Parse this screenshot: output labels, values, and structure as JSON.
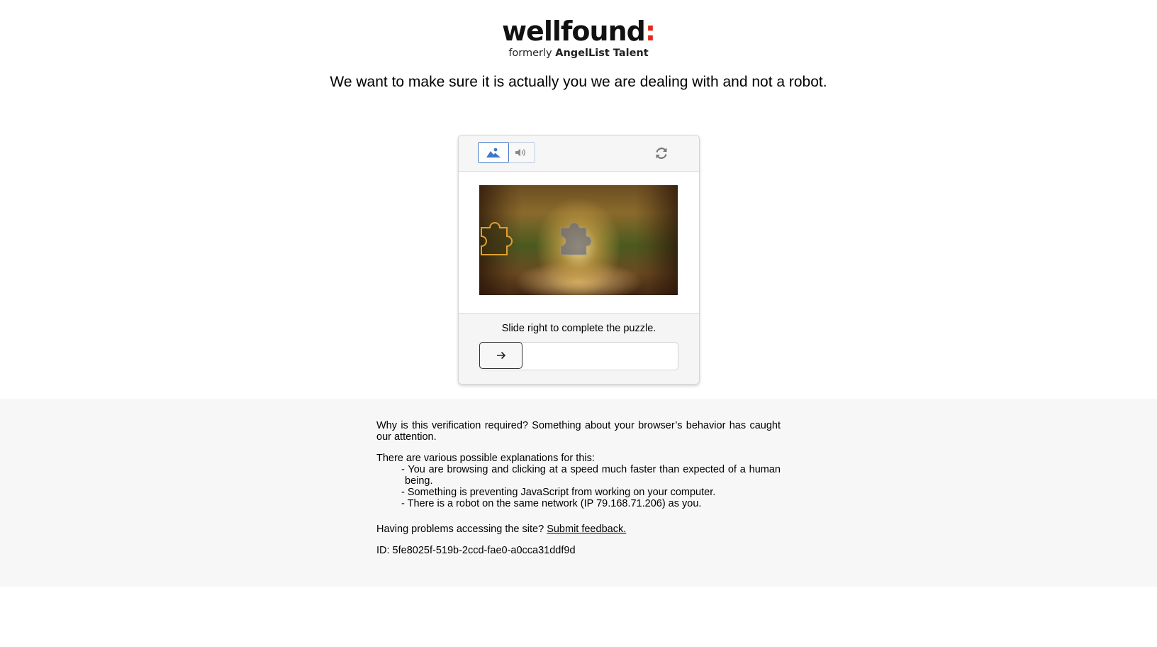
{
  "brand": {
    "name": "wellfound",
    "colon": ":",
    "formerly_prefix": "formerly",
    "formerly_name": "AngelList Talent",
    "accent_color": "#e0291a"
  },
  "headline": "We want to make sure it is actually you we are dealing with and not a robot.",
  "captcha": {
    "tabs": [
      {
        "label": "image",
        "icon": "image-icon",
        "selected": true
      },
      {
        "label": "audio",
        "icon": "speaker-icon",
        "selected": false
      }
    ],
    "refresh_icon": "refresh-icon",
    "instruction": "Slide right to complete the puzzle.",
    "slider_icon": "arrow-right-icon",
    "accent_color": "#3f79c5"
  },
  "info": {
    "why": "Why is this verification required? Something about your browser’s behavior has caught our attention.",
    "explanations_title": "There are various possible explanations for this:",
    "explanations": [
      "- You are browsing and clicking at a speed much faster than expected of a human being.",
      "- Something is preventing JavaScript from working on your computer.",
      "- There is a robot on the same network (IP 79.168.71.206) as you."
    ],
    "help_prefix": "Having problems accessing the site?",
    "help_link": "Submit feedback.",
    "id_line": "ID: 5fe8025f-519b-2ccd-fae0-a0cca31ddf9d"
  }
}
